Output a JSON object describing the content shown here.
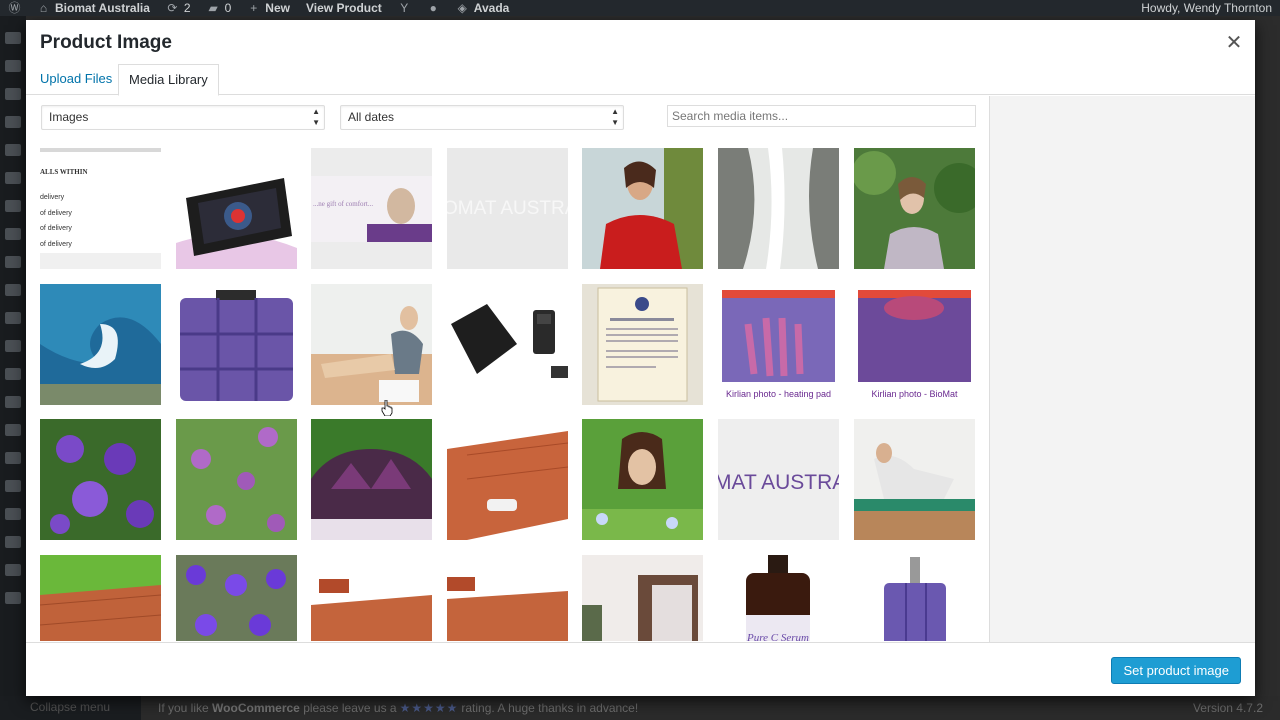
{
  "adminbar": {
    "site_name": "Biomat Australia",
    "updates_count": "2",
    "comments_count": "0",
    "new_label": "New",
    "view_product_label": "View Product",
    "theme_label": "Avada",
    "greeting": "Howdy, Wendy Thornton"
  },
  "modal": {
    "title": "Product Image",
    "close_icon": "close-icon"
  },
  "tabs": [
    {
      "label": "Upload Files",
      "active": false
    },
    {
      "label": "Media Library",
      "active": true
    }
  ],
  "filters": {
    "type_selected": "Images",
    "date_selected": "All dates",
    "search_placeholder": "Search media items..."
  },
  "grid": {
    "tiles": [
      {
        "name": "text-list",
        "caption": ""
      },
      {
        "name": "device-tablet",
        "caption": ""
      },
      {
        "name": "couple-on-mat",
        "caption": ""
      },
      {
        "name": "biomat-logo-faded",
        "caption": ""
      },
      {
        "name": "woman-red-shirt",
        "caption": ""
      },
      {
        "name": "waterfall",
        "caption": ""
      },
      {
        "name": "woman-in-nature",
        "caption": ""
      },
      {
        "name": "ocean-wave",
        "caption": ""
      },
      {
        "name": "purple-case",
        "caption": ""
      },
      {
        "name": "woman-relaxing-office",
        "caption": ""
      },
      {
        "name": "controller-device",
        "caption": ""
      },
      {
        "name": "warranty-certificate",
        "caption": ""
      },
      {
        "name": "kirlian-heating-pad",
        "caption": "Kirlian photo - heating pad"
      },
      {
        "name": "kirlian-biomat",
        "caption": "Kirlian photo - BioMat"
      },
      {
        "name": "purple-flowers-1",
        "caption": ""
      },
      {
        "name": "purple-flowers-2",
        "caption": ""
      },
      {
        "name": "amethyst-crystal",
        "caption": ""
      },
      {
        "name": "biomat-on-bed",
        "caption": ""
      },
      {
        "name": "woman-with-flowers",
        "caption": ""
      },
      {
        "name": "biomat-logo-text",
        "caption": ""
      },
      {
        "name": "woman-reading",
        "caption": ""
      },
      {
        "name": "mat-on-green",
        "caption": ""
      },
      {
        "name": "purple-flowers-3",
        "caption": ""
      },
      {
        "name": "mat-on-white-1",
        "caption": ""
      },
      {
        "name": "mat-on-white-2",
        "caption": ""
      },
      {
        "name": "pillow-on-chair",
        "caption": ""
      },
      {
        "name": "serum-bottle",
        "caption": ""
      },
      {
        "name": "purple-suitcase",
        "caption": ""
      }
    ],
    "logo_text_faded": "OMAT AUSTRA",
    "logo_text": "MAT AUSTRA",
    "text_list": {
      "heading": "ALLS WITHIN",
      "lines": [
        "delivery",
        "of delivery",
        "of delivery",
        "of delivery",
        "of delivery"
      ]
    },
    "couple_caption": "...ne gift of comfort...",
    "serum_label": "Pure C Serum"
  },
  "footer": {
    "set_button_label": "Set product image"
  },
  "page_footer": {
    "text_before": "If you like",
    "brand": "WooCommerce",
    "text_middle": "please leave us a",
    "stars": "★★★★★",
    "text_after": "rating. A huge thanks in advance!",
    "version": "Version 4.7.2"
  },
  "menu": {
    "collapse_label": "Collapse menu"
  },
  "colors": {
    "primary_button": "#1e9dd3",
    "link": "#0073aa",
    "adminbar": "#23282d"
  }
}
